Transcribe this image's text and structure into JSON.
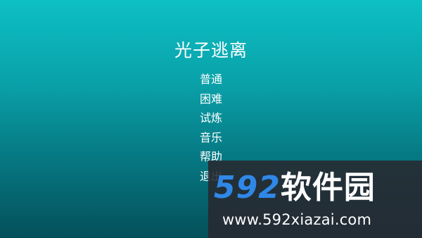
{
  "game": {
    "title": "光子逃离",
    "menu": [
      {
        "label": "普通"
      },
      {
        "label": "困难"
      },
      {
        "label": "试炼"
      },
      {
        "label": "音乐"
      },
      {
        "label": "帮助"
      },
      {
        "label": "退出"
      }
    ]
  },
  "watermark": {
    "logo_number": "592",
    "logo_text": "软件园",
    "url": "www.592xiazai.com"
  },
  "colors": {
    "background_top": "#0cc0c4",
    "background_bottom": "#04505a",
    "text": "#ffffff",
    "watermark_accent": "#2f88e8"
  }
}
